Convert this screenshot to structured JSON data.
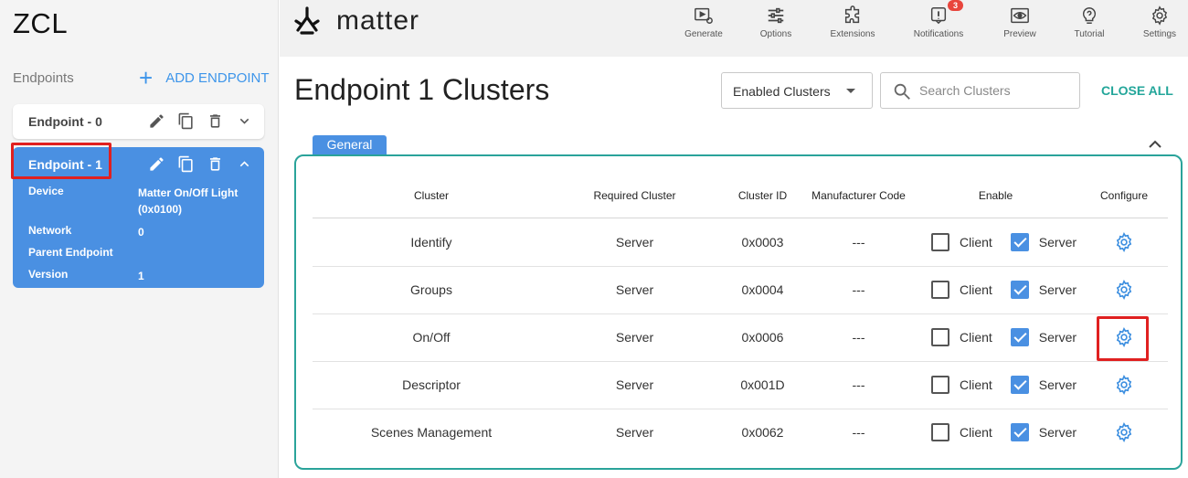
{
  "app": {
    "title": "ZCL",
    "logo_text": "matter"
  },
  "sidebar": {
    "endpoints_label": "Endpoints",
    "add_endpoint_label": "ADD ENDPOINT",
    "endpoints": [
      {
        "title": "Endpoint - 0",
        "expanded": false
      },
      {
        "title": "Endpoint - 1",
        "expanded": true,
        "selected": true,
        "details": {
          "device_label": "Device",
          "device_value": "Matter On/Off Light (0x0100)",
          "network_label": "Network",
          "network_value": "0",
          "parent_label": "Parent Endpoint",
          "parent_value": "",
          "version_label": "Version",
          "version_value": "1"
        }
      }
    ]
  },
  "toolbar": {
    "items": [
      {
        "label": "Generate",
        "icon": "generate-icon"
      },
      {
        "label": "Options",
        "icon": "options-icon"
      },
      {
        "label": "Extensions",
        "icon": "extensions-icon"
      },
      {
        "label": "Notifications",
        "icon": "notifications-icon",
        "badge": "3"
      },
      {
        "label": "Preview",
        "icon": "preview-icon"
      },
      {
        "label": "Tutorial",
        "icon": "tutorial-icon"
      },
      {
        "label": "Settings",
        "icon": "settings-icon"
      }
    ]
  },
  "main": {
    "title": "Endpoint 1 Clusters",
    "filter_value": "Enabled Clusters",
    "search_placeholder": "Search Clusters",
    "close_all_label": "CLOSE ALL",
    "group": {
      "name": "General",
      "columns": [
        "Cluster",
        "Required Cluster",
        "Cluster ID",
        "Manufacturer Code",
        "Enable",
        "Configure"
      ],
      "rows": [
        {
          "cluster": "Identify",
          "required": "Server",
          "id": "0x0003",
          "mfg": "---",
          "client_label": "Client",
          "client": false,
          "server_label": "Server",
          "server": true
        },
        {
          "cluster": "Groups",
          "required": "Server",
          "id": "0x0004",
          "mfg": "---",
          "client_label": "Client",
          "client": false,
          "server_label": "Server",
          "server": true
        },
        {
          "cluster": "On/Off",
          "required": "Server",
          "id": "0x0006",
          "mfg": "---",
          "client_label": "Client",
          "client": false,
          "server_label": "Server",
          "server": true
        },
        {
          "cluster": "Descriptor",
          "required": "Server",
          "id": "0x001D",
          "mfg": "---",
          "client_label": "Client",
          "client": false,
          "server_label": "Server",
          "server": true
        },
        {
          "cluster": "Scenes Management",
          "required": "Server",
          "id": "0x0062",
          "mfg": "---",
          "client_label": "Client",
          "client": false,
          "server_label": "Server",
          "server": true
        }
      ]
    }
  },
  "colors": {
    "accent": "#4a90e2",
    "teal": "#23a69a",
    "highlight": "#e02020"
  }
}
